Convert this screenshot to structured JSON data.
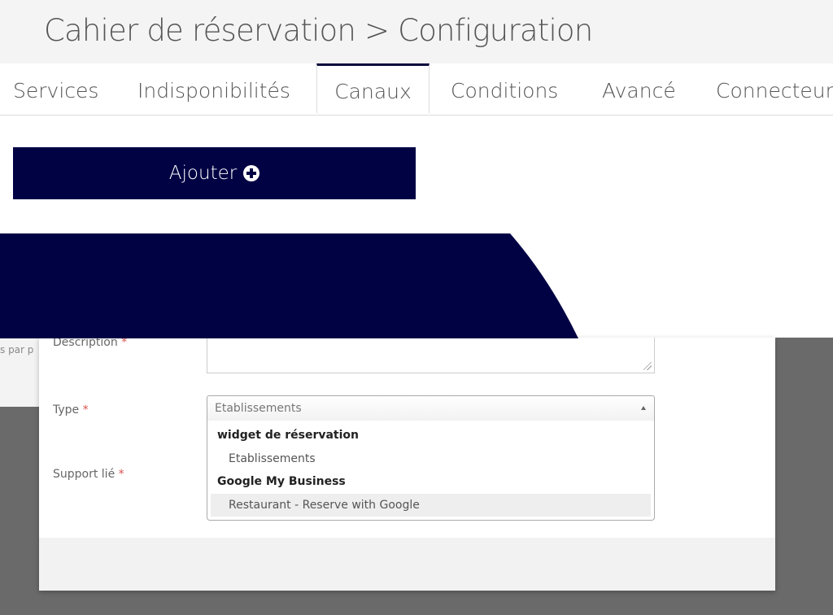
{
  "header": {
    "title": "Cahier de réservation > Configuration"
  },
  "tabs": [
    {
      "label": "Services",
      "active": false
    },
    {
      "label": "Indisponibilités",
      "active": false
    },
    {
      "label": "Canaux",
      "active": true
    },
    {
      "label": "Conditions",
      "active": false
    },
    {
      "label": "Avancé",
      "active": false
    },
    {
      "label": "Connecteurs",
      "active": false
    }
  ],
  "toolbar": {
    "add_label": "Ajouter",
    "add_icon": "plus-circle-icon"
  },
  "background": {
    "partial_text": "s par p"
  },
  "form": {
    "required_mark": "*",
    "description_label": "Description",
    "type_label": "Type",
    "support_label": "Support lié",
    "type_selected": "Etablissements",
    "type_options": {
      "group1_label": "widget de réservation",
      "group1_option1": "Etablissements",
      "group2_label": "Google My Business",
      "group2_option1": "Restaurant - Reserve with Google"
    }
  },
  "colors": {
    "primary": "#000244",
    "header_bg": "#f4f4f4",
    "backdrop": "#6a6a6a",
    "required": "#d9534f"
  }
}
